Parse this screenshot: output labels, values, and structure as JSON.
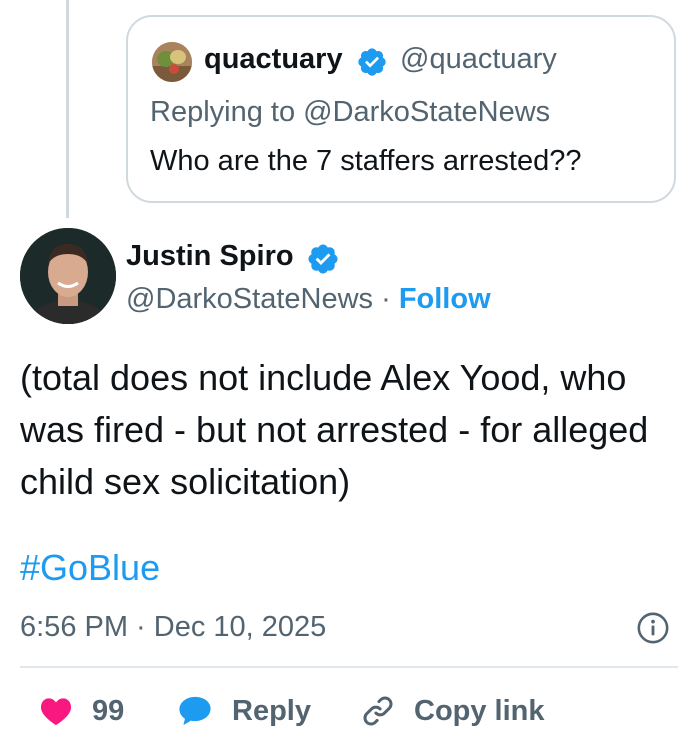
{
  "quoted": {
    "name": "quactuary",
    "handle": "@quactuary",
    "replying_to": "Replying to @DarkoStateNews",
    "text": "Who are the 7 staffers arrested??"
  },
  "tweet": {
    "author_name": "Justin Spiro",
    "author_handle": "@DarkoStateNews",
    "separator": " · ",
    "follow_label": "Follow",
    "text": "(total does not include Alex Yood, who was fired - but not arrested - for alleged child sex solicitation)",
    "hashtag": "#GoBlue",
    "timestamp": "6:56 PM · Dec 10, 2025"
  },
  "actions": {
    "like_count": "99",
    "reply_label": "Reply",
    "copy_label": "Copy link"
  },
  "icons": {
    "verified": "verified-badge-icon",
    "info": "info-icon",
    "like": "heart-icon",
    "reply": "speech-bubble-icon",
    "copy": "link-icon"
  },
  "colors": {
    "accent": "#1d9bf0",
    "like": "#f91880",
    "secondary_text": "#536471",
    "primary_text": "#0f1419",
    "border": "#cfd9de"
  }
}
